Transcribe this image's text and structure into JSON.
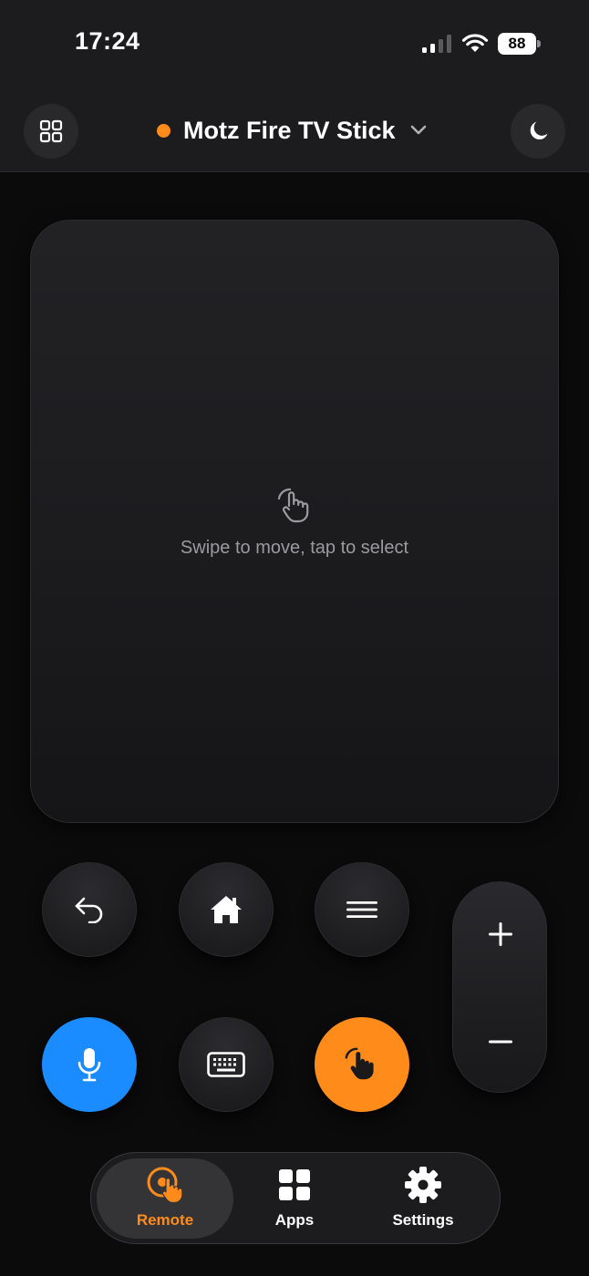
{
  "status_bar": {
    "time": "17:24",
    "battery": "88",
    "icons": [
      "cellular-signal-icon",
      "wifi-icon",
      "battery-icon"
    ]
  },
  "header": {
    "device_name": "Motz Fire TV Stick",
    "connection_status_color": "#ff8c1a",
    "icons": [
      "grid-icon",
      "chevron-down-icon",
      "moon-icon"
    ]
  },
  "touchpad": {
    "hint": "Swipe to move, tap to select",
    "icon": "tap-gesture-icon"
  },
  "controls": {
    "buttons": [
      "back-icon",
      "home-icon",
      "menu-icon",
      "microphone-icon",
      "keyboard-icon",
      "tap-gesture-icon"
    ],
    "volume": [
      "plus-icon",
      "minus-icon"
    ]
  },
  "tabbar": {
    "tabs": [
      {
        "label": "Remote",
        "icon": "remote-icon",
        "active": true
      },
      {
        "label": "Apps",
        "icon": "apps-icon",
        "active": false
      },
      {
        "label": "Settings",
        "icon": "gear-icon",
        "active": false
      }
    ]
  },
  "colors": {
    "accent": "#ff8c1a",
    "mic_button": "#1a8cff",
    "background": "#0b0b0c"
  }
}
